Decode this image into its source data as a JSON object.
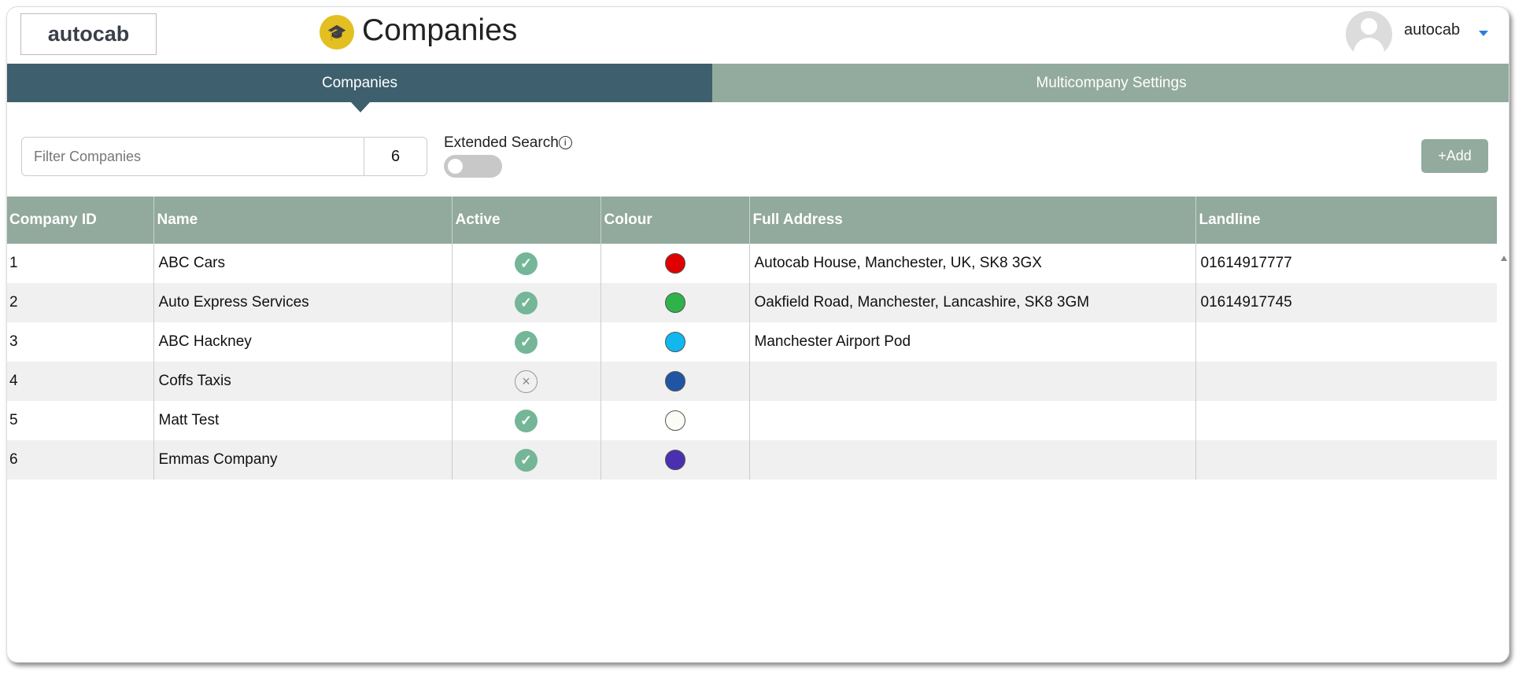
{
  "header": {
    "logo": "autocab",
    "title": "Companies",
    "title_icon": "graduation-cap-icon",
    "user": "autocab"
  },
  "tabs": [
    {
      "label": "Companies",
      "active": true
    },
    {
      "label": "Multicompany Settings",
      "active": false
    }
  ],
  "toolbar": {
    "filter_placeholder": "Filter Companies",
    "filter_value": "",
    "count": "6",
    "extended_search_label": "Extended Search",
    "extended_search_on": false,
    "info_glyph": "i",
    "add_label": "Add",
    "add_glyph": "+"
  },
  "table": {
    "columns": [
      "Company ID",
      "Name",
      "Active",
      "Colour",
      "Full Address",
      "Landline"
    ],
    "rows": [
      {
        "id": "1",
        "name": "ABC Cars",
        "active": true,
        "colour": "#e00000",
        "address": "Autocab House, Manchester, UK, SK8 3GX",
        "landline": "01614917777"
      },
      {
        "id": "2",
        "name": "Auto Express Services",
        "active": true,
        "colour": "#2db34a",
        "address": "Oakfield Road, Manchester, Lancashire, SK8 3GM",
        "landline": "01614917745"
      },
      {
        "id": "3",
        "name": "ABC Hackney",
        "active": true,
        "colour": "#10b8ef",
        "address": "Manchester Airport Pod",
        "landline": ""
      },
      {
        "id": "4",
        "name": "Coffs Taxis",
        "active": false,
        "colour": "#1f55a3",
        "address": "",
        "landline": ""
      },
      {
        "id": "5",
        "name": "Matt Test",
        "active": true,
        "colour": "#fbfcf6",
        "address": "",
        "landline": ""
      },
      {
        "id": "6",
        "name": "Emmas Company",
        "active": true,
        "colour": "#4a2fb0",
        "address": "",
        "landline": ""
      }
    ]
  }
}
